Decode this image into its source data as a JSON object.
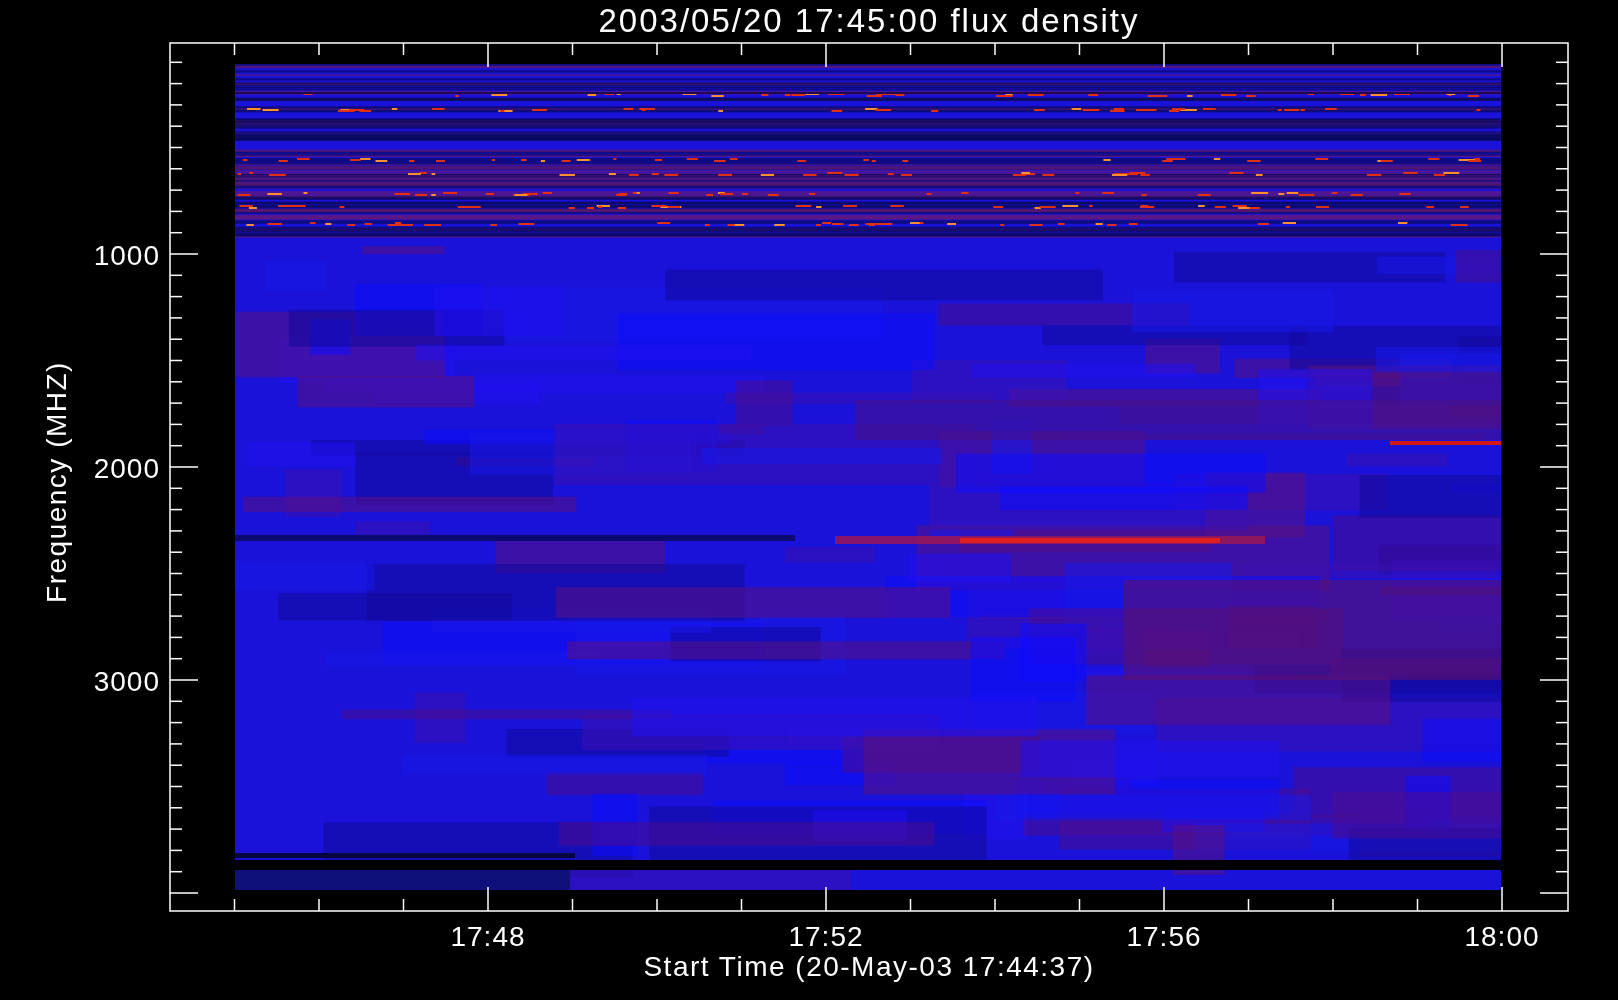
{
  "plot": {
    "title": "2003/05/20 17:45:00 flux density",
    "ylabel": "Frequency (MHZ)",
    "xlabel": "Start Time (20-May-03 17:44:37)",
    "yticks": [
      "1000",
      "2000",
      "3000"
    ],
    "xticks": [
      "17:48",
      "17:52",
      "17:56",
      "18:00"
    ]
  }
}
